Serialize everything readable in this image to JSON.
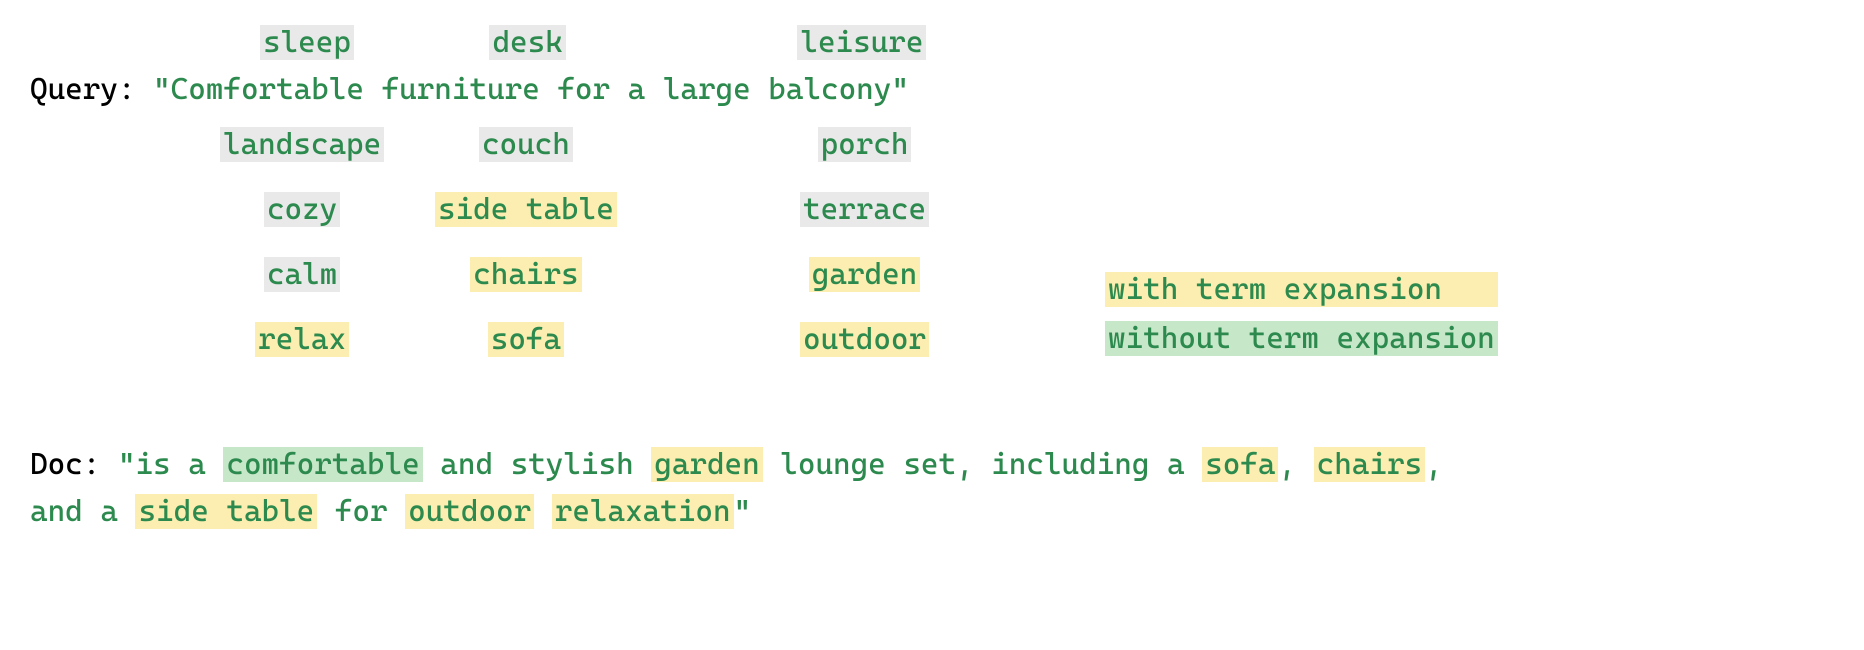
{
  "rowTop": {
    "w1": "sleep",
    "w2": "desk",
    "w3": "leisure"
  },
  "queryLabel": "Query:",
  "queryText": "\"Comfortable furniture for a large balcony\"",
  "col1": {
    "r1": "landscape",
    "r2": "cozy",
    "r3": "calm",
    "r4": "relax"
  },
  "col2": {
    "r1": "couch",
    "r2": "side table",
    "r3": "chairs",
    "r4": "sofa"
  },
  "col3": {
    "r1": "porch",
    "r2": "terrace",
    "r3": "garden",
    "r4": "outdoor"
  },
  "legend": {
    "with": "with term expansion",
    "without": "without term expansion"
  },
  "doc": {
    "label": "Doc:",
    "q1": "\"",
    "t1": "is a ",
    "m1": "comfortable",
    "t2": " and stylish ",
    "m2": "garden",
    "t3": " lounge set, including a ",
    "m3": "sofa",
    "c1": ", ",
    "m4": "chairs",
    "c2": ",",
    "t4": "and a ",
    "m5": "side table",
    "t5": " for ",
    "m6": "outdoor",
    "sp": " ",
    "m7": "relaxation",
    "q2": "\""
  }
}
